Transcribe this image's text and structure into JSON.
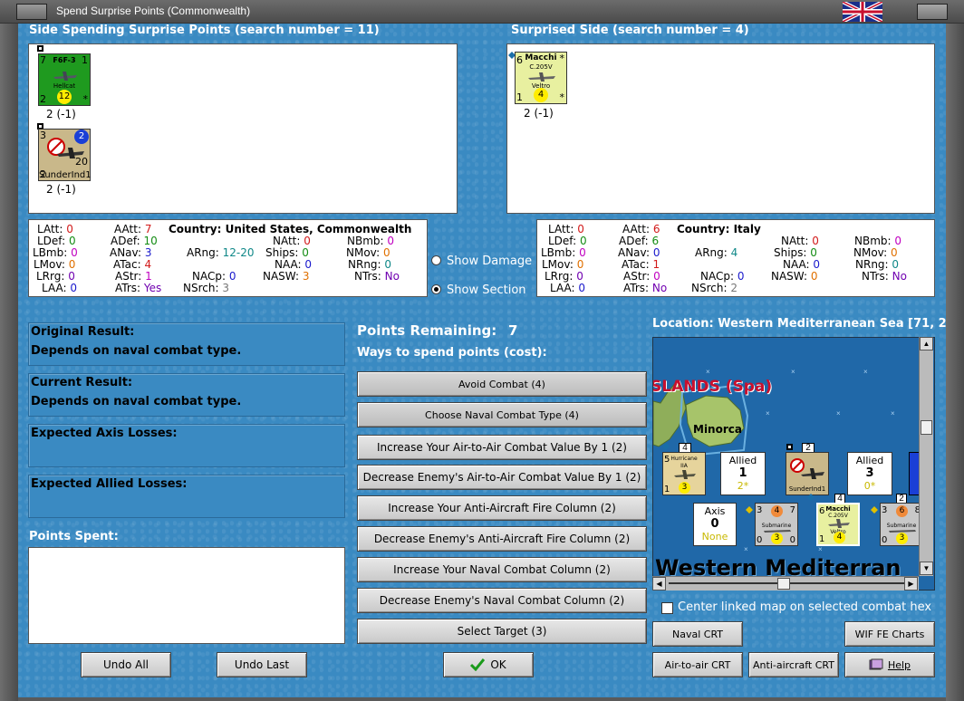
{
  "window": {
    "title": "Spend Surprise Points (Commonwealth)"
  },
  "spending": {
    "header": "Side Spending Surprise Points (search number = 11)",
    "units": [
      {
        "name": "F6F-3",
        "sub": "Hellcat",
        "tl": "7",
        "tr": "1",
        "bl": "2",
        "coin": "12",
        "br": "*",
        "label": "2 (-1)",
        "color": "#1f9a1f"
      },
      {
        "name": "SunderInd1",
        "tl": "3",
        "tr": "2",
        "bl": "2",
        "mr": "20",
        "label": "2 (-1)",
        "color": "#c9b88a"
      }
    ]
  },
  "surprised": {
    "header": "Surprised Side (search number = 4)",
    "units": [
      {
        "name": "Macchi",
        "sub": "C.205V",
        "sub2": "Veltro",
        "tl": "6",
        "tr": "*",
        "bl": "1",
        "coin": "4",
        "br": "*",
        "label": "2 (-1)",
        "color": "#e8f0a0"
      }
    ]
  },
  "stats_left": {
    "country": "Country: United States, Commonwealth",
    "items": {
      "LAtt": "0",
      "LDef": "0",
      "LBmb": "0",
      "LMov": "0",
      "LRrg": "0",
      "LAA": "0",
      "AAtt": "7",
      "ADef": "10",
      "ANav": "3",
      "ATac": "4",
      "AStr": "1",
      "ATrs": "Yes",
      "ARng": "12-20",
      "NACp": "0",
      "NSrch": "3",
      "NAtt": "0",
      "Ships": "0",
      "NAA": "0",
      "NASW": "3",
      "NBmb": "0",
      "NMov": "0",
      "NRng": "0",
      "NTrs": "No"
    }
  },
  "stats_right": {
    "country": "Country: Italy",
    "items": {
      "LAtt": "0",
      "LDef": "0",
      "LBmb": "0",
      "LMov": "0",
      "LRrg": "0",
      "LAA": "0",
      "AAtt": "6",
      "ADef": "6",
      "ANav": "0",
      "ATac": "1",
      "AStr": "0",
      "ATrs": "No",
      "ARng": "4",
      "NACp": "0",
      "NSrch": "2",
      "NAtt": "0",
      "Ships": "0",
      "NAA": "0",
      "NASW": "0",
      "NBmb": "0",
      "NMov": "0",
      "NRng": "0",
      "NTrs": "No"
    }
  },
  "options": {
    "show_damage": "Show Damage",
    "show_section": "Show Section"
  },
  "results": {
    "original_title": "Original Result:",
    "original_value": "Depends on naval combat type.",
    "current_title": "Current Result:",
    "current_value": "Depends on naval combat type.",
    "axis_losses": "Expected Axis Losses:",
    "allied_losses": "Expected Allied Losses:",
    "points_spent": "Points Spent:"
  },
  "points": {
    "label": "Points Remaining:",
    "value": "7",
    "ways": "Ways to spend points (cost):"
  },
  "actions": [
    "Avoid Combat (4)",
    "Choose Naval Combat Type (4)",
    "Increase Your Air-to-Air Combat Value By 1 (2)",
    "Decrease Enemy's Air-to-Air Combat Value By 1 (2)",
    "Increase Your Anti-Aircraft Fire Column (2)",
    "Decrease Enemy's Anti-Aircraft Fire Column (2)",
    "Increase Your Naval Combat Column (2)",
    "Decrease Enemy's Naval Combat Column (2)",
    "Select Target (3)"
  ],
  "location": "Location: Western Mediterranean Sea [71, 2",
  "map": {
    "islands": "SLANDS (Spa)",
    "minorca": "Minorca",
    "sea": "Western Mediterran",
    "units": {
      "hurricane": {
        "name": "Hurricane",
        "sub": "IIA",
        "tl": "5",
        "bl": "1",
        "coin": "3",
        "top": "4"
      },
      "allied1": {
        "t": "Allied",
        "n": "1",
        "s": "2*"
      },
      "sunder": {
        "name": "SunderInd1",
        "top": "2"
      },
      "allied2": {
        "t": "Allied",
        "n": "3",
        "s": "0*"
      },
      "axis": {
        "t": "Axis",
        "n": "0",
        "s": "None"
      },
      "sub1": {
        "name": "Submarine",
        "a": "3",
        "b": "4",
        "c": "7",
        "d": "0",
        "e": "3",
        "f": "0"
      },
      "macchi": {
        "name": "Macchi",
        "sub": "C.205V",
        "sub2": "Veltro",
        "top": "4",
        "tl": "6",
        "bl": "1",
        "coin": "4"
      },
      "sub2": {
        "name": "Submarine",
        "a": "3",
        "b": "6",
        "c": "8",
        "d": "0",
        "e": "3",
        "top": "2"
      }
    }
  },
  "center_map": "Center linked map on selected combat hex",
  "buttons": {
    "undo_all": "Undo All",
    "undo_last": "Undo Last",
    "ok": "OK",
    "naval_crt": "Naval CRT",
    "wif_fe": "WIF FE Charts",
    "air_crt": "Air-to-air CRT",
    "aa_crt": "Anti-aircraft CRT",
    "help": "Help"
  },
  "colors": {
    "panel_blue": "#3a8ac2",
    "sea": "#2068a8"
  }
}
